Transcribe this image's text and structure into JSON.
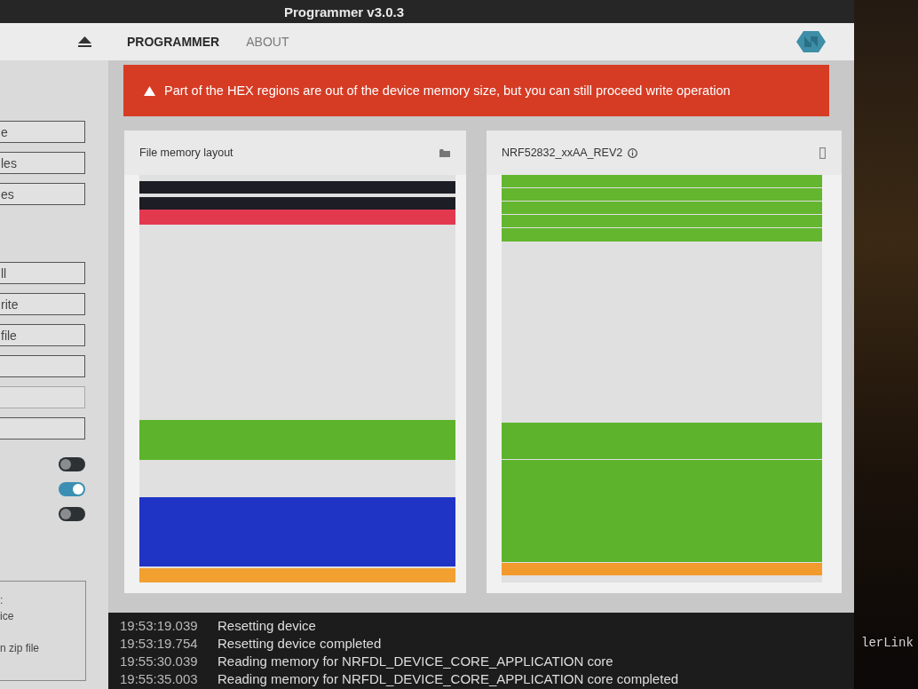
{
  "window": {
    "title": "Programmer v3.0.3"
  },
  "nav": {
    "tabs": [
      {
        "label": "PROGRAMMER",
        "selected": true
      },
      {
        "label": "ABOUT",
        "selected": false
      }
    ]
  },
  "sidebar": {
    "button_groups": [
      {
        "buttons": [
          {
            "label": "e",
            "disabled": false
          },
          {
            "label": "les",
            "disabled": false
          },
          {
            "label": "es",
            "disabled": false
          }
        ]
      },
      {
        "buttons": [
          {
            "label": "ll",
            "disabled": false
          },
          {
            "label": "rite",
            "disabled": false
          },
          {
            "label": "file",
            "disabled": false
          },
          {
            "disabled": false
          },
          {
            "disabled": true
          },
          {
            "disabled": false
          }
        ]
      }
    ],
    "toggles": [
      {
        "on": false
      },
      {
        "on": true
      },
      {
        "on": false
      }
    ],
    "info_box": {
      "paragraphs": [
        [
          ":",
          "ice"
        ],
        [
          "n zip file"
        ]
      ]
    }
  },
  "alert": {
    "message": "Part of the HEX regions are out of the device memory size, but you can still proceed write operation"
  },
  "file_layout": {
    "title": "File memory layout",
    "regions": [
      {
        "color": "#1d1d26"
      },
      {
        "color": "#1d1d26"
      },
      {
        "color": "#e2394f"
      },
      {
        "color": "#5db42c"
      },
      {
        "color": "#1f33c4"
      },
      {
        "color": "#f2a030"
      }
    ]
  },
  "device_layout": {
    "title": "NRF52832_xxAA_REV2",
    "regions": [
      {
        "color": "#63b62e"
      },
      {
        "color": "#63b62e"
      },
      {
        "color": "#63b62e"
      },
      {
        "color": "#63b62e"
      },
      {
        "color": "#63b62e"
      },
      {
        "color": "#5db42c"
      },
      {
        "color": "#5db42c"
      },
      {
        "color": "#f29a2c"
      }
    ]
  },
  "log": [
    {
      "time": "19:53:19.039",
      "message": "Resetting device"
    },
    {
      "time": "19:53:19.754",
      "message": "Resetting device completed"
    },
    {
      "time": "19:55:30.039",
      "message": "Reading memory for NRFDL_DEVICE_CORE_APPLICATION core"
    },
    {
      "time": "19:55:35.003",
      "message": "Reading memory for NRFDL_DEVICE_CORE_APPLICATION core completed"
    }
  ],
  "background_text": "lerLink"
}
